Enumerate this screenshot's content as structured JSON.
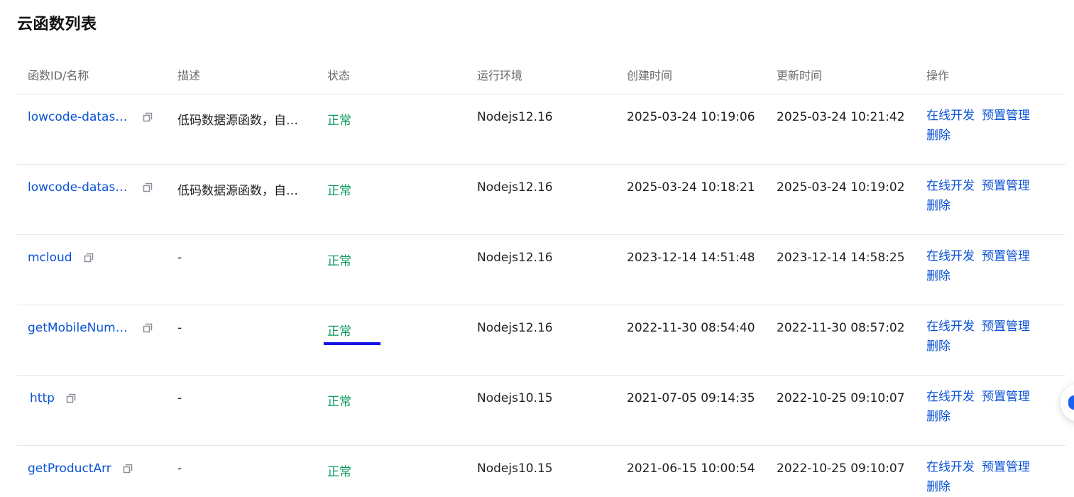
{
  "page": {
    "title": "云函数列表"
  },
  "table": {
    "headers": {
      "name": "函数ID/名称",
      "desc": "描述",
      "status": "状态",
      "env": "运行环境",
      "created": "创建时间",
      "updated": "更新时间",
      "ops": "操作"
    },
    "rows": [
      {
        "name": "lowcode-dataso…",
        "desc": "低码数据源函数，自…",
        "status": "正常",
        "env": "Nodejs12.16",
        "created": "2025-03-24 10:19:06",
        "updated": "2025-03-24 10:21:42"
      },
      {
        "name": "lowcode-dataso…",
        "desc": "低码数据源函数，自…",
        "status": "正常",
        "env": "Nodejs12.16",
        "created": "2025-03-24 10:18:21",
        "updated": "2025-03-24 10:19:02"
      },
      {
        "name": "mcloud",
        "desc": "-",
        "status": "正常",
        "env": "Nodejs12.16",
        "created": "2023-12-14 14:51:48",
        "updated": "2023-12-14 14:58:25"
      },
      {
        "name": "getMobileNumber",
        "desc": "-",
        "status": "正常",
        "env": "Nodejs12.16",
        "created": "2022-11-30 08:54:40",
        "updated": "2022-11-30 08:57:02"
      },
      {
        "name": "http",
        "desc": "-",
        "status": "正常",
        "env": "Nodejs10.15",
        "created": "2021-07-05 09:14:35",
        "updated": "2022-10-25 09:10:07"
      },
      {
        "name": "getProductArr",
        "desc": "-",
        "status": "正常",
        "env": "Nodejs10.15",
        "created": "2021-06-15 10:00:54",
        "updated": "2022-10-25 09:10:07"
      }
    ],
    "ops": {
      "develop": "在线开发",
      "provision": "预置管理",
      "delete": "删除"
    }
  },
  "colors": {
    "link": "#0a52d4",
    "status_ok": "#0a9a5c",
    "highlight_underline": "#1212e6"
  },
  "icons": {
    "copy": "copy-icon",
    "float": "assistant-icon"
  }
}
